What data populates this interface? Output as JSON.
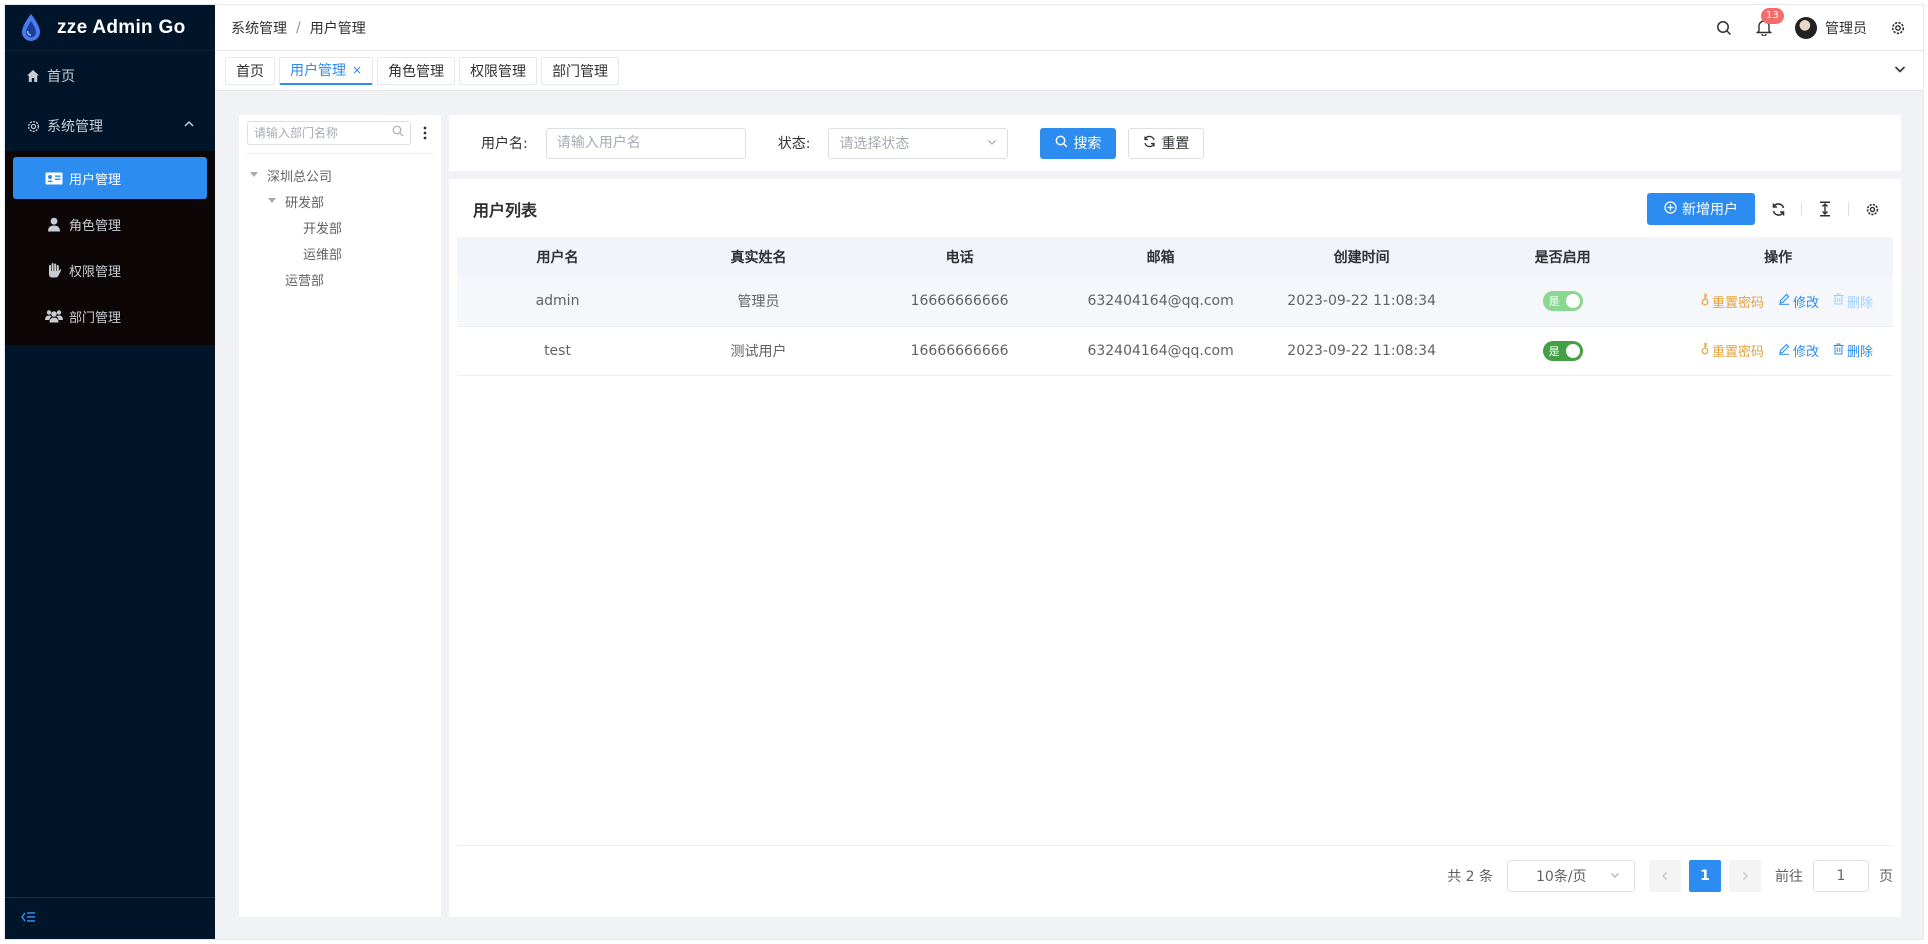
{
  "app": {
    "title": "zze Admin Go"
  },
  "sidebar": {
    "home_label": "首页",
    "group_label": "系统管理",
    "items": [
      {
        "label": "用户管理",
        "icon": "user-card-icon",
        "active": true
      },
      {
        "label": "角色管理",
        "icon": "person-icon",
        "active": false
      },
      {
        "label": "权限管理",
        "icon": "hand-icon",
        "active": false
      },
      {
        "label": "部门管理",
        "icon": "team-icon",
        "active": false
      }
    ]
  },
  "header": {
    "breadcrumb": [
      "系统管理",
      "用户管理"
    ],
    "breadcrumb_sep": "/",
    "notification_count": "13",
    "username": "管理员"
  },
  "tabs": [
    {
      "label": "首页",
      "active": false
    },
    {
      "label": "用户管理",
      "active": true,
      "close": "×"
    },
    {
      "label": "角色管理",
      "active": false
    },
    {
      "label": "权限管理",
      "active": false
    },
    {
      "label": "部门管理",
      "active": false
    }
  ],
  "tree": {
    "search_placeholder": "请输入部门名称",
    "nodes": [
      {
        "label": "深圳总公司",
        "level": 0,
        "expanded": true
      },
      {
        "label": "研发部",
        "level": 1,
        "expanded": true
      },
      {
        "label": "开发部",
        "level": 2
      },
      {
        "label": "运维部",
        "level": 2
      },
      {
        "label": "运营部",
        "level": 1
      }
    ]
  },
  "filter": {
    "username_label": "用户名:",
    "username_placeholder": "请输入用户名",
    "status_label": "状态:",
    "status_placeholder": "请选择状态",
    "search_button": "搜索",
    "reset_button": "重置"
  },
  "table": {
    "title": "用户列表",
    "add_button": "新增用户",
    "columns": [
      "用户名",
      "真实姓名",
      "电话",
      "邮箱",
      "创建时间",
      "是否启用",
      "操作"
    ],
    "rows": [
      {
        "username": "admin",
        "realname": "管理员",
        "phone": "16666666666",
        "email": "632404164@qq.com",
        "created": "2023-09-22 11:08:34",
        "enabled_text": "是",
        "delete_disabled": true
      },
      {
        "username": "test",
        "realname": "测试用户",
        "phone": "16666666666",
        "email": "632404164@qq.com",
        "created": "2023-09-22 11:08:34",
        "enabled_text": "是",
        "delete_disabled": false
      }
    ],
    "actions": {
      "reset_password": "重置密码",
      "edit": "修改",
      "delete": "删除"
    }
  },
  "pagination": {
    "total_text": "共 2 条",
    "page_size": "10条/页",
    "current_page": "1",
    "goto_label": "前往",
    "goto_value": "1",
    "page_unit": "页"
  },
  "colors": {
    "primary": "#2d8cf0",
    "sidebar_bg": "#001529",
    "warning": "#e6a23c",
    "switch_on": "#43a047"
  }
}
